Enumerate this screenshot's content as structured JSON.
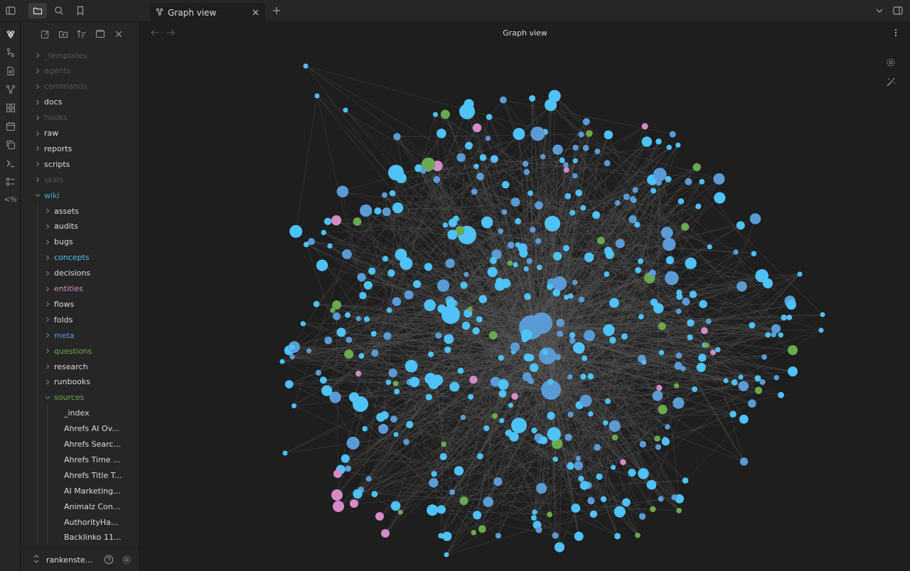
{
  "tab": {
    "title": "Graph view",
    "icon": "graph-icon"
  },
  "view": {
    "title": "Graph view"
  },
  "vault": {
    "name": "rankenste..."
  },
  "ribbon_icons": [
    "obsidian-logo-icon",
    "git-icon",
    "file-search-icon",
    "graph-icon",
    "canvas-icon",
    "calendar-icon",
    "copy-icon",
    "terminal-icon",
    "list-icon",
    "templater-icon"
  ],
  "explorer_tools": [
    "new-note-icon",
    "new-folder-icon",
    "sort-icon",
    "collapse-icon",
    "close-icon"
  ],
  "tree": [
    {
      "label": "_templates",
      "depth": 0,
      "type": "folder",
      "color": "#555555"
    },
    {
      "label": "agents",
      "depth": 0,
      "type": "folder",
      "color": "#555555"
    },
    {
      "label": "commands",
      "depth": 0,
      "type": "folder",
      "color": "#555555"
    },
    {
      "label": "docs",
      "depth": 0,
      "type": "folder",
      "color": "#dcdcdc"
    },
    {
      "label": "hooks",
      "depth": 0,
      "type": "folder",
      "color": "#555555"
    },
    {
      "label": "raw",
      "depth": 0,
      "type": "folder",
      "color": "#dcdcdc"
    },
    {
      "label": "reports",
      "depth": 0,
      "type": "folder",
      "color": "#dcdcdc"
    },
    {
      "label": "scripts",
      "depth": 0,
      "type": "folder",
      "color": "#dcdcdc"
    },
    {
      "label": "skills",
      "depth": 0,
      "type": "folder",
      "color": "#555555"
    },
    {
      "label": "wiki",
      "depth": 0,
      "type": "folder-open",
      "color": "#4aa8d8"
    },
    {
      "label": "assets",
      "depth": 1,
      "type": "folder",
      "color": "#dcdcdc"
    },
    {
      "label": "audits",
      "depth": 1,
      "type": "folder",
      "color": "#dcdcdc"
    },
    {
      "label": "bugs",
      "depth": 1,
      "type": "folder",
      "color": "#dcdcdc"
    },
    {
      "label": "concepts",
      "depth": 1,
      "type": "folder",
      "color": "#4fc3f7"
    },
    {
      "label": "decisions",
      "depth": 1,
      "type": "folder",
      "color": "#dcdcdc"
    },
    {
      "label": "entities",
      "depth": 1,
      "type": "folder",
      "color": "#d48bc8"
    },
    {
      "label": "flows",
      "depth": 1,
      "type": "folder",
      "color": "#dcdcdc"
    },
    {
      "label": "folds",
      "depth": 1,
      "type": "folder",
      "color": "#dcdcdc"
    },
    {
      "label": "meta",
      "depth": 1,
      "type": "folder",
      "color": "#5b9bd5"
    },
    {
      "label": "questions",
      "depth": 1,
      "type": "folder",
      "color": "#6aaa4f"
    },
    {
      "label": "research",
      "depth": 1,
      "type": "folder",
      "color": "#dcdcdc"
    },
    {
      "label": "runbooks",
      "depth": 1,
      "type": "folder",
      "color": "#dcdcdc"
    },
    {
      "label": "sources",
      "depth": 1,
      "type": "folder-open",
      "color": "#6aaa4f"
    },
    {
      "label": "_index",
      "depth": 2,
      "type": "file",
      "color": "#dcdcdc"
    },
    {
      "label": "Ahrefs AI Ov...",
      "depth": 2,
      "type": "file",
      "color": "#dcdcdc"
    },
    {
      "label": "Ahrefs Searc...",
      "depth": 2,
      "type": "file",
      "color": "#dcdcdc"
    },
    {
      "label": "Ahrefs Time ...",
      "depth": 2,
      "type": "file",
      "color": "#dcdcdc"
    },
    {
      "label": "Ahrefs Title T...",
      "depth": 2,
      "type": "file",
      "color": "#dcdcdc"
    },
    {
      "label": "AI Marketing...",
      "depth": 2,
      "type": "file",
      "color": "#dcdcdc"
    },
    {
      "label": "Animalz Con...",
      "depth": 2,
      "type": "file",
      "color": "#dcdcdc"
    },
    {
      "label": "AuthorityHa...",
      "depth": 2,
      "type": "file",
      "color": "#dcdcdc"
    },
    {
      "label": "Backlinko 11...",
      "depth": 2,
      "type": "file",
      "color": "#dcdcdc"
    }
  ],
  "graph_colors": {
    "concept": "#4fc3f7",
    "meta": "#5b9bd5",
    "question": "#6aaa4f",
    "entity": "#d48bc8",
    "edge": "#5a5a5a"
  }
}
